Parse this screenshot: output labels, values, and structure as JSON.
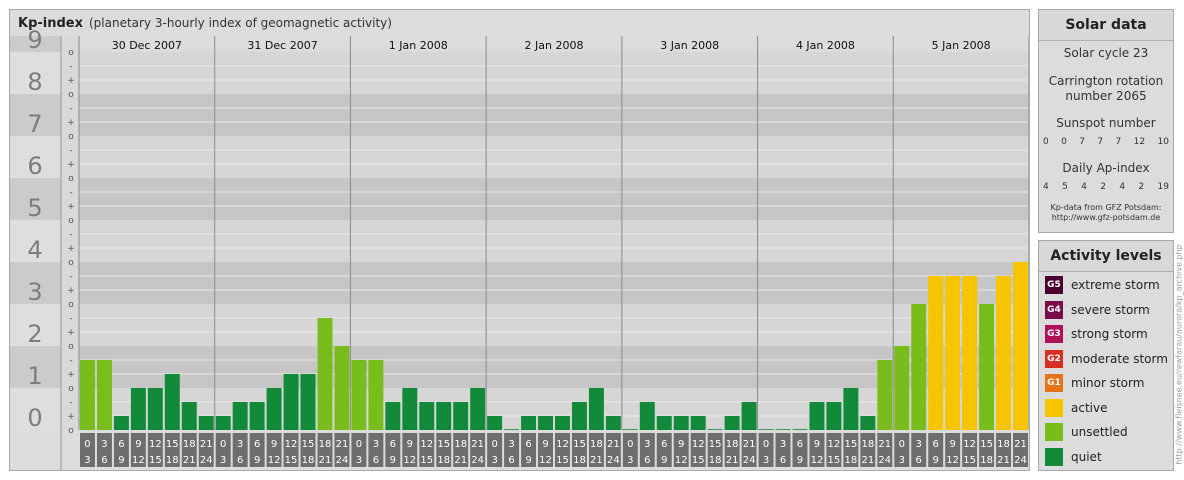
{
  "header": {
    "title": "Kp-index",
    "subtitle": "(planetary 3-hourly index of geomagnetic activity)"
  },
  "chart_data": {
    "type": "bar",
    "title": "Kp-index",
    "subtitle": "(planetary 3-hourly index of geomagnetic activity)",
    "ylim": [
      0,
      9
    ],
    "y_ticks": [
      "0",
      "1",
      "2",
      "3",
      "4",
      "5",
      "6",
      "7",
      "8",
      "9"
    ],
    "sub_ticks": [
      "o",
      "+",
      "-"
    ],
    "days": [
      "30 Dec 2007",
      "31 Dec 2007",
      "1 Jan 2008",
      "2 Jan 2008",
      "3 Jan 2008",
      "4 Jan 2008",
      "5 Jan 2008"
    ],
    "hour_labels_top": [
      "0",
      "3",
      "6",
      "9",
      "12",
      "15",
      "18",
      "21"
    ],
    "hour_labels_bottom": [
      "3",
      "6",
      "9",
      "12",
      "15",
      "18",
      "21",
      "24"
    ],
    "values": [
      1.667,
      1.667,
      0.333,
      1.0,
      1.0,
      1.333,
      0.667,
      0.333,
      0.333,
      0.667,
      0.667,
      1.0,
      1.333,
      1.333,
      2.667,
      2.0,
      1.667,
      1.667,
      0.667,
      1.0,
      0.667,
      0.667,
      0.667,
      1.0,
      0.333,
      0.0,
      0.333,
      0.333,
      0.333,
      0.667,
      1.0,
      0.333,
      0.0,
      0.667,
      0.333,
      0.333,
      0.333,
      0.0,
      0.333,
      0.667,
      0.0,
      0.0,
      0.0,
      0.667,
      0.667,
      1.0,
      0.333,
      1.667,
      2.0,
      3.0,
      3.667,
      3.667,
      3.667,
      3.0,
      3.667,
      4.0
    ],
    "colors": {
      "quiet": "#138a3a",
      "unsettled": "#79bd1d",
      "active": "#f7c400"
    },
    "grid": true
  },
  "solar": {
    "title": "Solar data",
    "cycle": "Solar cycle 23",
    "carrington_1": "Carrington rotation",
    "carrington_2": "number 2065",
    "sunspot_label": "Sunspot number",
    "sunspot_values": [
      "0",
      "0",
      "7",
      "7",
      "7",
      "12",
      "10"
    ],
    "ap_label": "Daily Ap-index",
    "ap_values": [
      "4",
      "5",
      "4",
      "2",
      "4",
      "2",
      "19"
    ],
    "source_1": "Kp-data from GFZ Potsdam:",
    "source_2": "http://www.gfz-potsdam.de"
  },
  "activity": {
    "title": "Activity levels",
    "levels": [
      {
        "code": "G5",
        "label": "extreme storm",
        "color": "#4a0030"
      },
      {
        "code": "G4",
        "label": "severe storm",
        "color": "#7a0a4a"
      },
      {
        "code": "G3",
        "label": "strong storm",
        "color": "#b0105a"
      },
      {
        "code": "G2",
        "label": "moderate storm",
        "color": "#d83020"
      },
      {
        "code": "G1",
        "label": "minor storm",
        "color": "#e8741a"
      },
      {
        "code": "",
        "label": "active",
        "color": "#f7c400"
      },
      {
        "code": "",
        "label": "unsettled",
        "color": "#79bd1d"
      },
      {
        "code": "",
        "label": "quiet",
        "color": "#138a3a"
      }
    ]
  },
  "watermark": "http://www.fleisnee.eu/rewfarau/aurora/kp_archive.php"
}
